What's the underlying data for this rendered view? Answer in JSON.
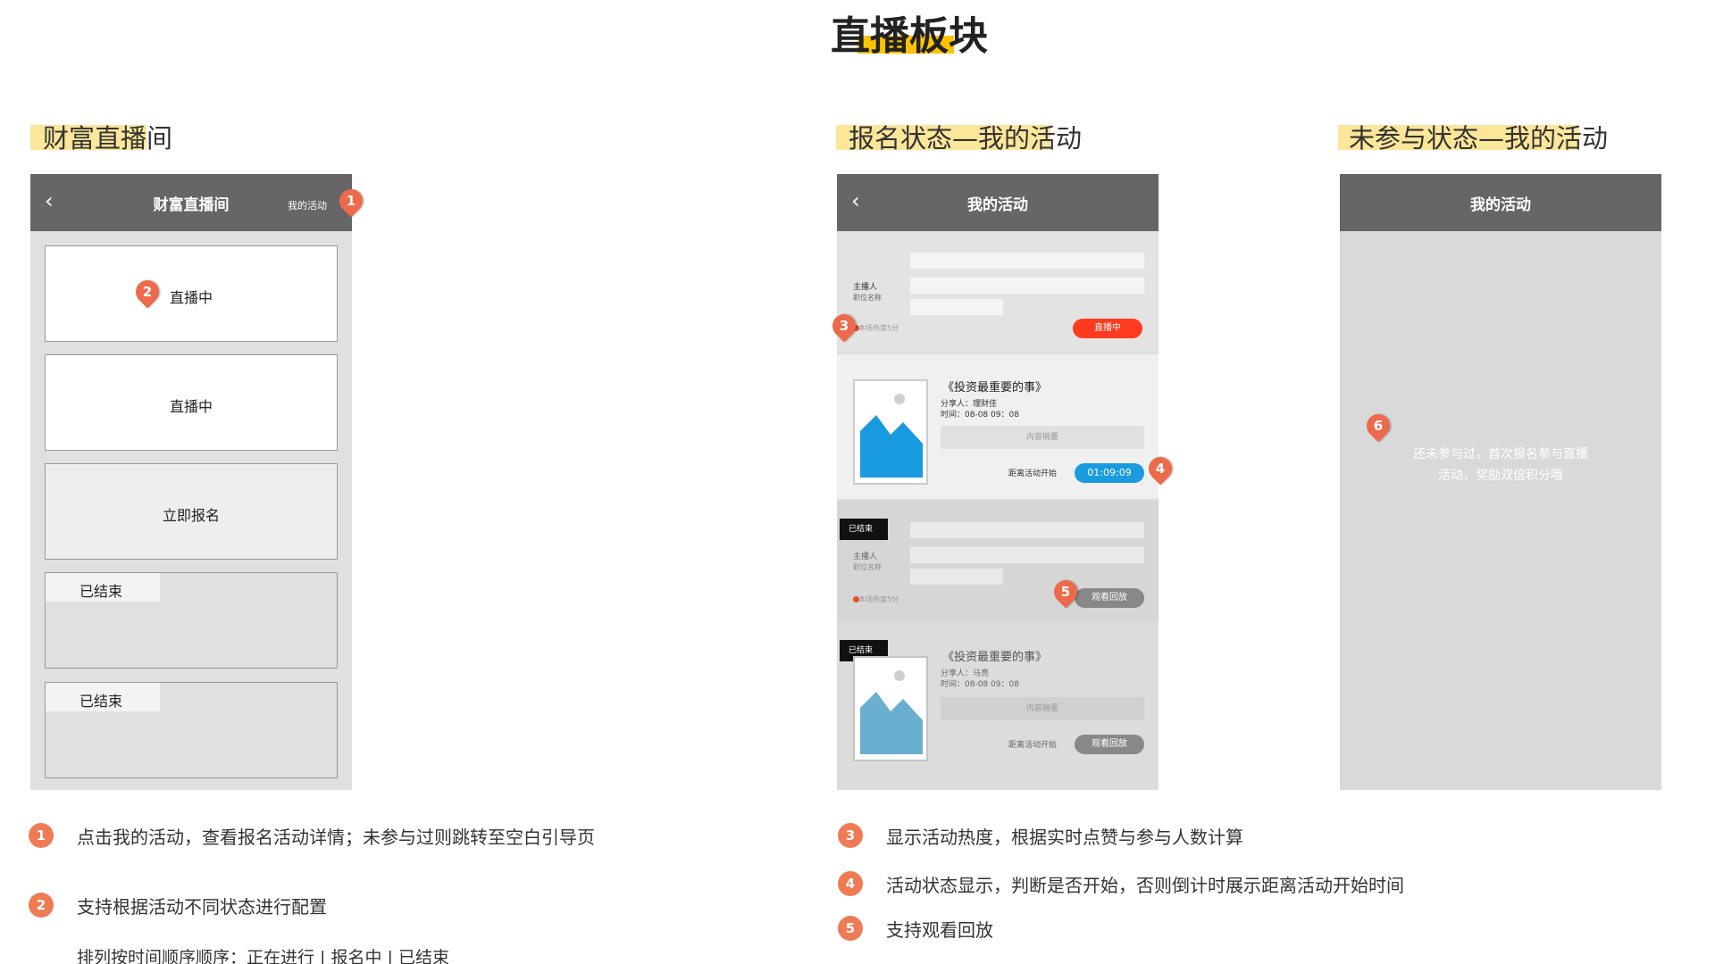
{
  "page_title": "直播板块",
  "sections": {
    "left": "财富直播间",
    "middle": "报名状态—我的活动",
    "right": "未参与状态—我的活动"
  },
  "left_phone": {
    "back_icon": "chevron-left-icon",
    "title": "财富直播间",
    "my_activity": "我的活动",
    "cards": [
      "直播中",
      "直播中",
      "立即报名"
    ],
    "ended_label": "已结束"
  },
  "middle_phone": {
    "title": "我的活动",
    "host_label": "主播人",
    "position_label": "职位名称",
    "heat_text": "本场热度5分",
    "live_pill": "直播中",
    "book_title": "《投资最重要的事》",
    "sharer": "分享人：理财佳",
    "time": "时间：08-08 09：08",
    "summary": "内容摘要",
    "countdown_label": "距离活动开始",
    "countdown_value": "01:09:09",
    "ended_tag": "已结束",
    "replay": "观看回放",
    "sharer2": "分享人：马亮"
  },
  "right_phone": {
    "title": "我的活动",
    "empty_text_line1": "还未参与过，首次报名参与直播",
    "empty_text_line2": "活动，奖励双倍积分哦"
  },
  "markers": [
    "1",
    "2",
    "3",
    "4",
    "5",
    "6"
  ],
  "notes": {
    "n1": "点击我的活动，查看报名活动详情；未参与过则跳转至空白引导页",
    "n2": "支持根据活动不同状态进行配置",
    "n2_sub": "排列按时间顺序顺序：正在进行 | 报名中 | 已结束",
    "n3": "显示活动热度，根据实时点赞与参与人数计算",
    "n4": "活动状态显示，判断是否开始，否则倒计时展示距离活动开始时间",
    "n5": "支持观看回放"
  },
  "colors": {
    "accent_yellow": "#fcc400",
    "heading_highlight": "#fbe69a",
    "marker_orange": "#ee6a4c",
    "live_red": "#ff3b1f",
    "countdown_blue": "#1a9be0",
    "navbar_gray": "#666666"
  }
}
